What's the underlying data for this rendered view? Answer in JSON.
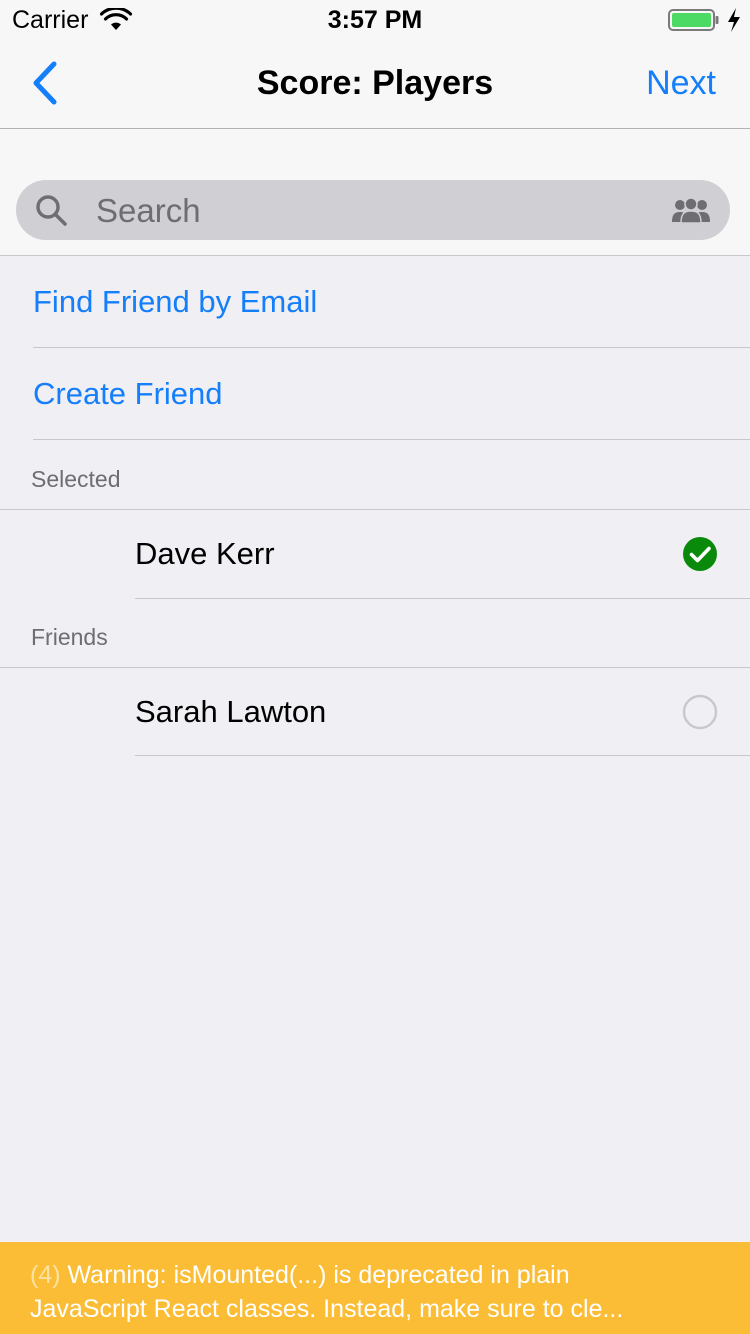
{
  "status_bar": {
    "carrier": "Carrier",
    "time": "3:57 PM",
    "icons": [
      "wifi-icon",
      "battery-icon",
      "charging-icon"
    ]
  },
  "nav": {
    "title": "Score: Players",
    "next_label": "Next",
    "back_icon": "chevron-left-icon",
    "accent_color": "#147efb"
  },
  "search": {
    "placeholder": "Search",
    "icons": [
      "search-icon",
      "people-icon"
    ]
  },
  "actions": [
    {
      "label": "Find Friend by Email"
    },
    {
      "label": "Create Friend"
    }
  ],
  "sections": {
    "selected": {
      "header": "Selected",
      "players": [
        {
          "name": "Dave Kerr",
          "checked": true
        }
      ]
    },
    "friends": {
      "header": "Friends",
      "players": [
        {
          "name": "Sarah Lawton",
          "checked": false
        }
      ]
    }
  },
  "warning": {
    "count": "(4)",
    "line1": "Warning: isMounted(...) is deprecated in plain",
    "line2": "JavaScript React classes. Instead, make sure to cle...",
    "color": "#fbbd36"
  },
  "colors": {
    "check_green": "#0a8a0a",
    "radio_gray": "#c7c7cc",
    "background": "#efeff4"
  }
}
